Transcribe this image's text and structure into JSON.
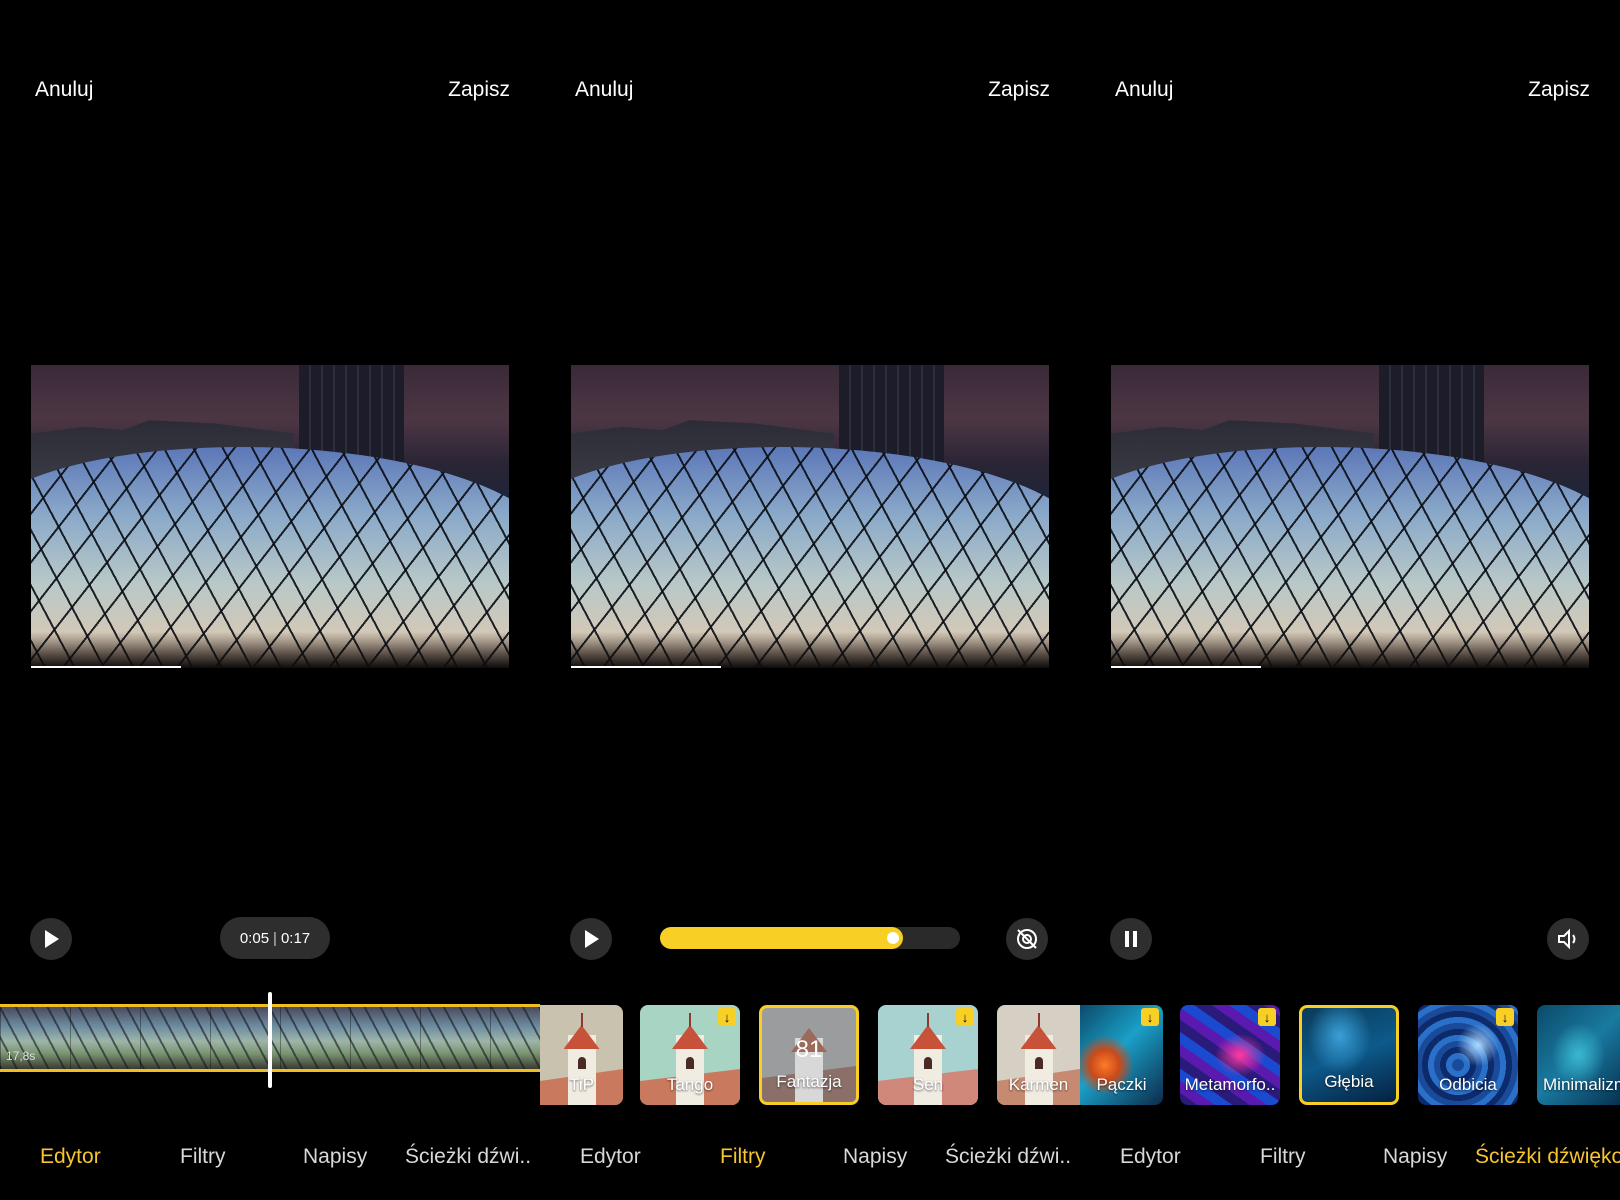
{
  "panels": [
    {
      "cancel": "Anuluj",
      "save": "Zapisz",
      "play_icon": "play-icon",
      "time_current": "0:05",
      "time_separator": "|",
      "time_total": "0:17",
      "timeline_duration": "17,8s",
      "tabs": [
        "Edytor",
        "Filtry",
        "Napisy",
        "Ścieżki dźwi.."
      ],
      "active_tab": 0
    },
    {
      "cancel": "Anuluj",
      "save": "Zapisz",
      "play_icon": "play-icon",
      "filter_intensity": 0.81,
      "hide_icon": "hide-original-icon",
      "filters": [
        {
          "label": "TiP",
          "style": "church",
          "download": false,
          "selected": false
        },
        {
          "label": "Tango",
          "style": "church",
          "download": true,
          "selected": false
        },
        {
          "label": "Fantazja",
          "style": "church",
          "download": false,
          "selected": true,
          "value": "81"
        },
        {
          "label": "Sen",
          "style": "church",
          "download": true,
          "selected": false
        },
        {
          "label": "Karmen",
          "style": "church",
          "download": false,
          "selected": false
        }
      ],
      "tabs": [
        "Edytor",
        "Filtry",
        "Napisy",
        "Ścieżki dźwi.."
      ],
      "active_tab": 1
    },
    {
      "cancel": "Anuluj",
      "save": "Zapisz",
      "pause_icon": "pause-icon",
      "volume_icon": "volume-icon",
      "filters": [
        {
          "label": "Pączki",
          "style": "abstract-orange",
          "download": true,
          "selected": false
        },
        {
          "label": "Metamorfo..",
          "style": "abstract-purple",
          "download": true,
          "selected": false
        },
        {
          "label": "Głębia",
          "style": "abstract-deep",
          "download": false,
          "selected": true
        },
        {
          "label": "Odbicia",
          "style": "abstract-odbicia",
          "download": true,
          "selected": false
        },
        {
          "label": "Minimalizm",
          "style": "abstract-min",
          "download": false,
          "selected": false
        }
      ],
      "tabs": [
        "Edytor",
        "Filtry",
        "Napisy",
        "Ścieżki dźwiękowe"
      ],
      "active_tab": 3
    }
  ],
  "colors": {
    "accent": "#f7cf25",
    "tab_active": "#f7c530",
    "control_bg": "#2e2e2e"
  }
}
